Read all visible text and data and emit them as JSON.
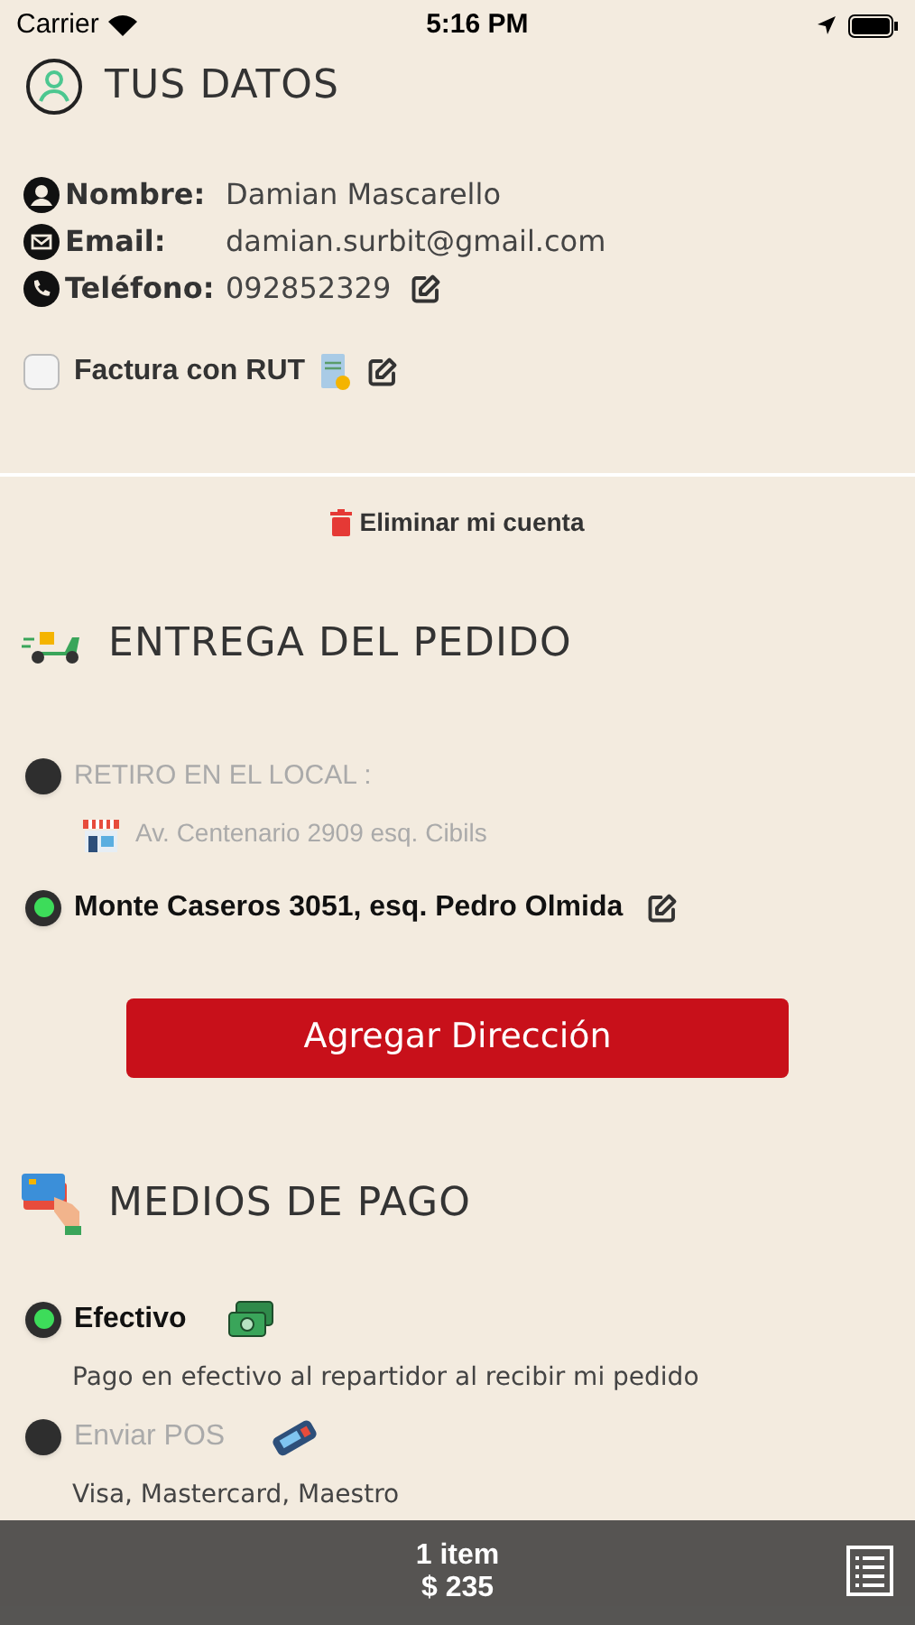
{
  "status_bar": {
    "carrier": "Carrier",
    "time": "5:16 PM"
  },
  "profile": {
    "title": "TUS DATOS",
    "fields": [
      {
        "kind": "name",
        "label": "Nombre:",
        "value": "Damian Mascarello",
        "editable": false
      },
      {
        "kind": "email",
        "label": "Email:",
        "value": "damian.surbit@gmail.com",
        "editable": false
      },
      {
        "kind": "phone",
        "label": "Teléfono:",
        "value": "092852329",
        "editable": true
      }
    ],
    "invoice": {
      "label": "Factura con RUT",
      "checked": false
    }
  },
  "delete_account": "Eliminar mi cuenta",
  "delivery": {
    "title": "ENTREGA DEL PEDIDO",
    "options": [
      {
        "label": "RETIRO EN EL LOCAL :",
        "address": "Av. Centenario 2909 esq. Cibils",
        "selected": false
      },
      {
        "label": "Monte Caseros 3051, esq. Pedro Olmida",
        "selected": true
      }
    ],
    "add_button": "Agregar Dirección"
  },
  "payment": {
    "title": "MEDIOS DE PAGO",
    "options": [
      {
        "kind": "cash",
        "label": "Efectivo",
        "description": "Pago en efectivo al repartidor al recibir mi pedido",
        "selected": true
      },
      {
        "kind": "pos",
        "label": "Enviar POS",
        "description": "Visa, Mastercard, Maestro",
        "selected": false
      }
    ]
  },
  "cart_bar": {
    "count": "1 item",
    "total": "$ 235"
  }
}
